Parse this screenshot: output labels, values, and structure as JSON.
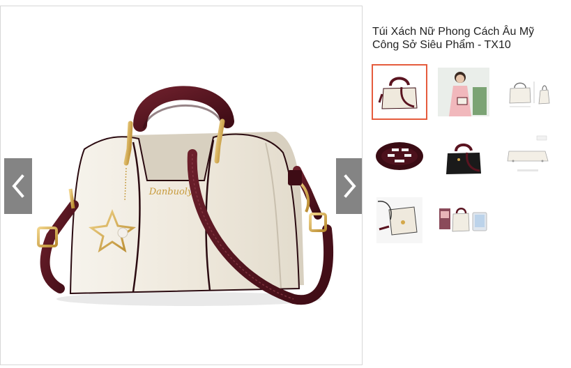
{
  "product": {
    "title": "Túi Xách Nữ Phong Cách Âu Mỹ Công Sở Siêu Phẩm - TX10",
    "brand_engraving": "Danbuoly"
  },
  "gallery": {
    "prev_icon": "chevron-left-icon",
    "next_icon": "chevron-right-icon",
    "active_index": 0,
    "thumbnails": [
      {
        "name": "thumb-white-bag"
      },
      {
        "name": "thumb-model-pink-dress"
      },
      {
        "name": "thumb-size-diagram"
      },
      {
        "name": "thumb-bag-interior"
      },
      {
        "name": "thumb-black-bag"
      },
      {
        "name": "thumb-bag-bottom"
      },
      {
        "name": "thumb-bag-detail"
      },
      {
        "name": "thumb-bag-with-tablet"
      }
    ]
  },
  "colors": {
    "accent_border": "#e55b3c",
    "arrow_bg": "#7a7a7a",
    "bag_cream": "#f1ede3",
    "bag_burgundy": "#5a1420",
    "hardware_gold": "#d4a84a"
  }
}
